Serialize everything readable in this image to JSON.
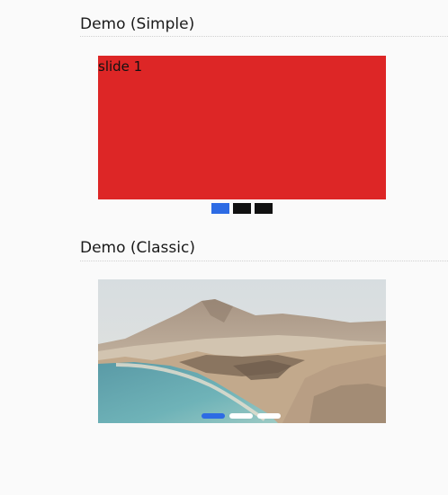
{
  "sections": {
    "simple": {
      "title": "Demo (Simple)",
      "slide_label": "slide 1",
      "slide_color": "#dd2626",
      "slides_total": 3,
      "active_index": 0
    },
    "classic": {
      "title": "Demo (Classic)",
      "image_subject": "coastal landscape with mountains and turquoise sea",
      "slides_total": 3,
      "active_index": 0
    }
  },
  "colors": {
    "accent": "#2d6be4",
    "inactive_square": "#111111",
    "inactive_pill": "#ffffff"
  }
}
